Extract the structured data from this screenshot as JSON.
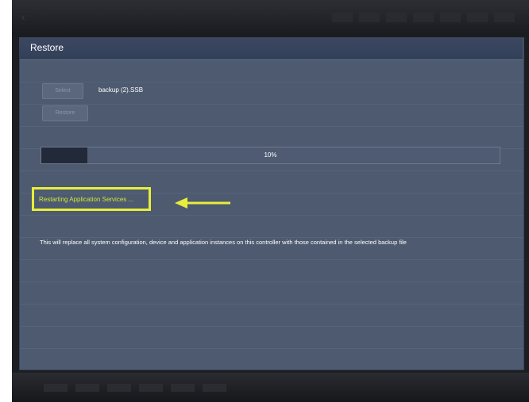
{
  "dialog": {
    "title": "Restore"
  },
  "file": {
    "select_label": "Select",
    "filename": "backup (2).SSB",
    "restore_label": "Restore"
  },
  "progress": {
    "percent": 10,
    "label": "10%"
  },
  "status": {
    "text": "Restarting Application Services ..."
  },
  "warning": {
    "text": "This will replace all system configuration, device and application instances on this controller with those contained in the selected backup file"
  },
  "colors": {
    "dialog_bg": "#4d5a70",
    "titlebar_bg": "#3c4860",
    "progress_fill": "#222938",
    "status_text": "#c9e93a",
    "highlight": "#e8ee3a"
  },
  "icons": {
    "annotation": "arrow-left-icon"
  }
}
